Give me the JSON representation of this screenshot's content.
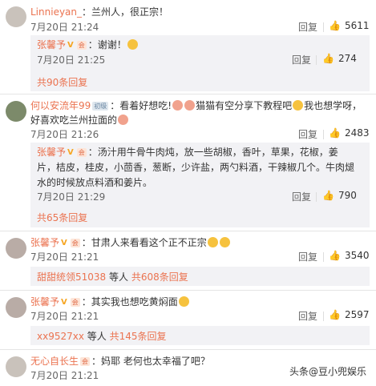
{
  "comments": [
    {
      "user": "Linnieyan_",
      "text": "：兰州人，很正宗！",
      "time": "7月20日 21:24",
      "reply": "回复",
      "likes": "5611",
      "sub": {
        "user": "张馨予",
        "text": "：谢谢！",
        "time": "7月20日 21:25",
        "reply": "回复",
        "likes": "274"
      },
      "more": "共90条回复"
    },
    {
      "user": "何以安流年99",
      "level": "初级",
      "text_l1": "：看着好想吃!",
      "text_l1b": "猫猫有空分享下教程吧",
      "text_l1c": "我也想学呀，",
      "text_l2": "好喜欢吃兰州拉面的",
      "time": "7月20日 21:26",
      "reply": "回复",
      "likes": "2483",
      "sub": {
        "user": "张馨予",
        "text_l1": "：汤汁用牛骨牛肉炖，放一些胡椒，香叶，草果，花椒，姜",
        "text_l2": "片，桔皮，桂皮，小茴香，葱断，少许盐，两勺料酒，干辣椒几个。牛肉煺",
        "text_l3": "水的时候放点料酒和姜片。",
        "time": "7月20日 21:29",
        "reply": "回复",
        "likes": "790"
      },
      "more": "共65条回复"
    },
    {
      "user": "张馨予",
      "text": "：甘肃人来看看这个正不正宗",
      "time": "7月20日 21:21",
      "reply": "回复",
      "likes": "3540",
      "more_prefix": "甜甜统领51038",
      "more_mid": " 等人 ",
      "more": "共608条回复"
    },
    {
      "user": "张馨予",
      "text": "：其实我也想吃黄焖面",
      "time": "7月20日 21:21",
      "reply": "回复",
      "likes": "2597",
      "more_prefix": "xx9527xx",
      "more_mid": " 等人 ",
      "more": "共145条回复"
    },
    {
      "user": "无心自长生",
      "text": "：妈耶 老何也太幸福了吧？",
      "time": "7月20日 21:21"
    }
  ],
  "badges": {
    "verified": "V",
    "vip": "会"
  },
  "watermark": "头条@豆小兜娱乐"
}
